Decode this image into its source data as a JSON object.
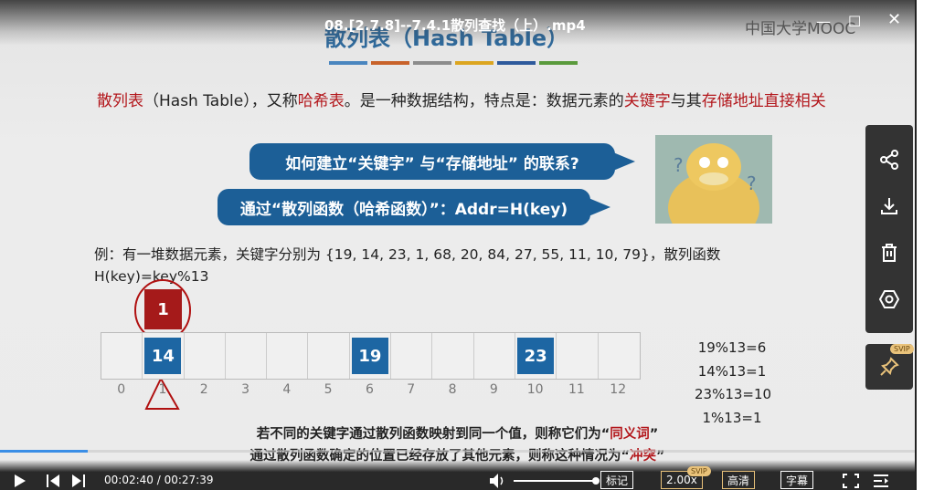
{
  "player": {
    "file_title": "08.[2.7.8]--7.4.1散列查找（上）.mp4",
    "logo": "中国大学MOOC",
    "time_current": "00:02:40",
    "time_total": "00:27:39",
    "time_sep": " / ",
    "progress_fraction": 0.096,
    "volume_fraction": 1.0,
    "buttons": {
      "mark": "标记",
      "speed": "2.00x",
      "speed_badge": "SVIP",
      "quality": "高清",
      "subtitle": "字幕"
    },
    "side_panel": [
      "share-icon",
      "download-icon",
      "trash-icon",
      "settings-icon"
    ],
    "pin_badge": "SVIP",
    "accent": "#3a8ee6"
  },
  "slide": {
    "title": "散列表（Hash Table）",
    "bar_colors": [
      "#4a86bf",
      "#c8622a",
      "#8c8c8c",
      "#dca520",
      "#2e5a9c",
      "#5a9a3c"
    ],
    "para": [
      {
        "t": "散列表",
        "red": true
      },
      {
        "t": "（Hash Table），又称",
        "red": false
      },
      {
        "t": "哈希表",
        "red": true
      },
      {
        "t": "。是一种数据结构，特点是：数据元素的",
        "red": false
      },
      {
        "t": "关键字",
        "red": true
      },
      {
        "t": "与其",
        "red": false
      },
      {
        "t": "存储地址直接相关",
        "red": true
      }
    ],
    "bubble1": "如何建立“关键字” 与“存储地址” 的联系?",
    "bubble2": "通过“散列函数（哈希函数）”：Addr=H(key)",
    "example_line1": "例：有一堆数据元素，关键字分别为 {19, 14, 23, 1, 68, 20, 84, 27, 55, 11, 10, 79}，散列函数",
    "example_line2": "H(key)=key%13",
    "collision_value": "1",
    "table": [
      "",
      "14",
      "",
      "",
      "",
      "",
      "19",
      "",
      "",
      "",
      "23",
      "",
      ""
    ],
    "indices": [
      "0",
      "1",
      "2",
      "3",
      "4",
      "5",
      "6",
      "7",
      "8",
      "9",
      "10",
      "11",
      "12"
    ],
    "formulas": [
      "19%13=6",
      "14%13=1",
      "23%13=10",
      "1%13=1"
    ],
    "note1_a": "若不同的关键字通过散列函数映射到同一个值，则称它们为“",
    "note1_b": "同义词",
    "note1_c": "”",
    "note2_a": "通过散列函数确定的位置已经存放了其他元素，则称这种情况为“",
    "note2_b": "冲突",
    "note2_c": "”"
  }
}
